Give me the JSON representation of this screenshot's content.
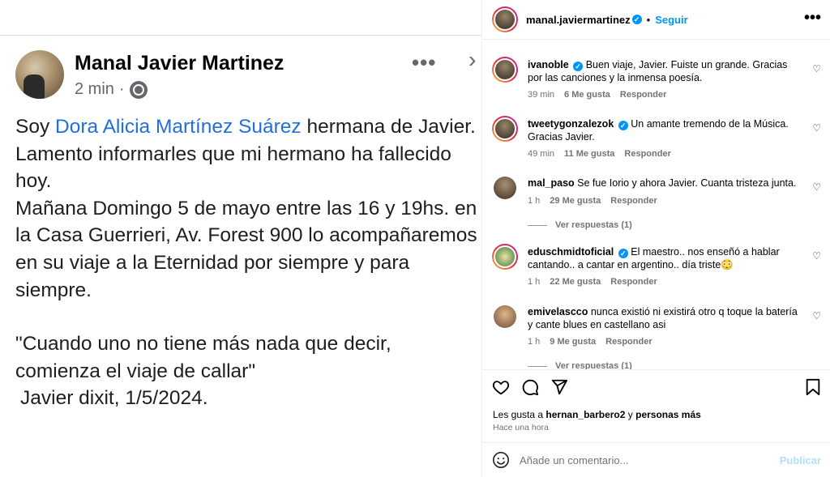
{
  "facebook_post": {
    "author": "Manal Javier Martinez",
    "time": "2 min",
    "separator": "·",
    "more_icon": "more-horizontal-icon",
    "body_intro": "Soy ",
    "mention": "Dora Alicia Martínez Suárez",
    "body_rest": " hermana de Javier. Lamento informarles que mi hermano ha fallecido hoy.",
    "body_line2": "Mañana Domingo 5 de mayo entre las 16 y 19hs. en la Casa Guerrieri, Av. Forest 900 lo acompañaremos en su viaje a la Eternidad por siempre y para siempre.",
    "quote": "\"Cuando uno no tiene más nada que decir, comienza el viaje de callar\"",
    "signature": "Javier dixit, 1/5/2024."
  },
  "instagram": {
    "header": {
      "username": "manal.javiermartinez",
      "verified_icon": "✓",
      "dot": "•",
      "follow_label": "Seguir",
      "more_label": "•••"
    },
    "comments": [
      {
        "username": "ivanoble",
        "verified": true,
        "text": "Buen viaje, Javier. Fuiste un grande. Gracias por las canciones y la inmensa poesía.",
        "time": "39 min",
        "likes": "6 Me gusta",
        "reply": "Responder"
      },
      {
        "username": "tweetygonzalezok",
        "verified": true,
        "text": "Un amante tremendo de la Música. Gracias Javier.",
        "time": "49 min",
        "likes": "11 Me gusta",
        "reply": "Responder"
      },
      {
        "username": "mal_paso",
        "verified": false,
        "text": "Se fue Iorio y ahora Javier. Cuanta tristeza junta.",
        "time": "1 h",
        "likes": "29 Me gusta",
        "reply": "Responder",
        "view_replies": "Ver respuestas (1)"
      },
      {
        "username": "eduschmidtoficial",
        "verified": true,
        "text": "El maestro.. nos enseñó a hablar cantando.. a cantar en argentino.. día triste😳",
        "time": "1 h",
        "likes": "22 Me gusta",
        "reply": "Responder"
      },
      {
        "username": "emivelascco",
        "verified": false,
        "text": "nunca existió ni existirá otro q toque la batería y cante blues en castellano asi",
        "time": "1 h",
        "likes": "9 Me gusta",
        "reply": "Responder",
        "view_replies": "Ver respuestas (1)"
      }
    ],
    "actions": {
      "likes_prefix": "Les gusta a ",
      "liked_by": "hernan_barbero2",
      "likes_middle": " y ",
      "likes_others": "personas más",
      "posted_time": "Hace una hora"
    },
    "comment_box": {
      "placeholder": "Añade un comentario...",
      "publish_label": "Publicar"
    }
  }
}
